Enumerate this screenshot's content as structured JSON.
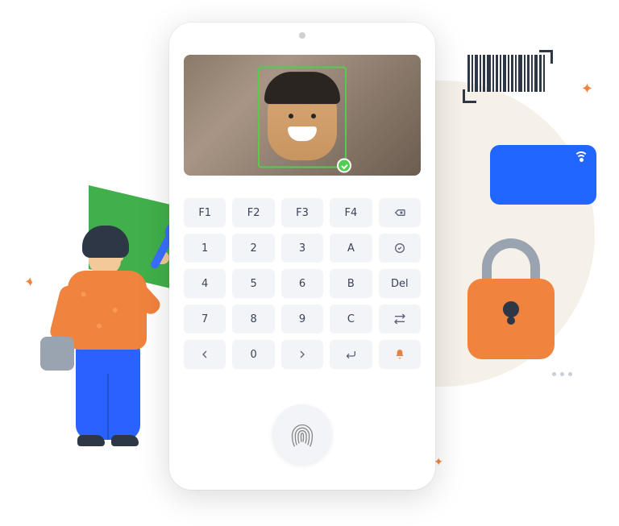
{
  "keypad": {
    "rows": [
      [
        "F1",
        "F2",
        "F3",
        "F4",
        ""
      ],
      [
        "1",
        "2",
        "3",
        "A",
        ""
      ],
      [
        "4",
        "5",
        "6",
        "B",
        "Del"
      ],
      [
        "7",
        "8",
        "9",
        "C",
        ""
      ],
      [
        "",
        "0",
        "",
        "",
        ""
      ]
    ],
    "nav_left_icon": "chevron-left-icon",
    "nav_right_icon": "chevron-right-icon",
    "enter_icon": "enter-icon",
    "shuffle_icon": "shuffle-icon",
    "bell_icon": "bell-icon",
    "backspace_icon": "backspace-icon",
    "check_icon": "check-icon"
  },
  "colors": {
    "accent": "#f0833e",
    "blue": "#2166ff",
    "green": "#41b04a",
    "face_box": "#4fcf4f"
  }
}
